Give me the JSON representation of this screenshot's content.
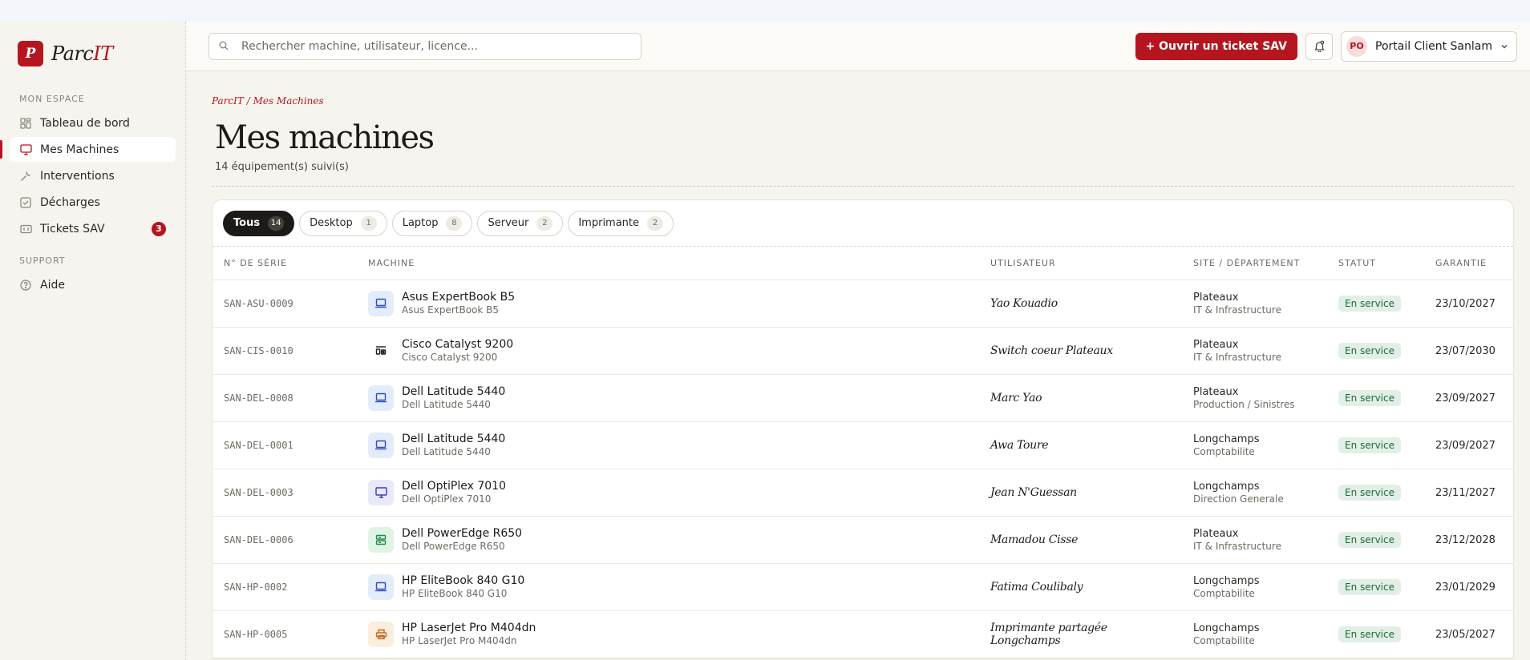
{
  "brand": {
    "mark": "P",
    "name_prefix": "Parc",
    "name_accent": "IT"
  },
  "sidebar": {
    "section_main": "Mon espace",
    "items": [
      {
        "label": "Tableau de bord",
        "icon": "grid-icon"
      },
      {
        "label": "Mes Machines",
        "icon": "monitor-icon",
        "active": true
      },
      {
        "label": "Interventions",
        "icon": "wrench-icon"
      },
      {
        "label": "Décharges",
        "icon": "checkbox-icon"
      },
      {
        "label": "Tickets SAV",
        "icon": "ticket-icon",
        "badge": "3"
      }
    ],
    "section_support": "Support",
    "support_items": [
      {
        "label": "Aide",
        "icon": "help-icon"
      }
    ]
  },
  "topbar": {
    "search_placeholder": "Rechercher machine, utilisateur, licence...",
    "open_ticket_label": "+ Ouvrir un ticket SAV",
    "account_initials": "PO",
    "account_name": "Portail Client Sanlam"
  },
  "page": {
    "breadcrumb": "ParcIT / Mes Machines",
    "title": "Mes machines",
    "subtitle": "14 équipement(s) suivi(s)"
  },
  "filters": [
    {
      "label": "Tous",
      "count": "14",
      "active": true
    },
    {
      "label": "Desktop",
      "count": "1"
    },
    {
      "label": "Laptop",
      "count": "8"
    },
    {
      "label": "Serveur",
      "count": "2"
    },
    {
      "label": "Imprimante",
      "count": "2"
    }
  ],
  "table": {
    "headers": [
      "N° de série",
      "Machine",
      "Utilisateur",
      "Site / Département",
      "Statut",
      "Garantie"
    ],
    "rows": [
      {
        "serial": "SAN-ASU-0009",
        "type": "laptop",
        "name": "Asus ExpertBook B5",
        "model": "Asus ExpertBook B5",
        "user": "Yao Kouadio",
        "site": "Plateaux",
        "dept": "IT & Infrastructure",
        "status": "En service",
        "warranty": "23/10/2027"
      },
      {
        "serial": "SAN-CIS-0010",
        "type": "switch",
        "name": "Cisco Catalyst 9200",
        "model": "Cisco Catalyst 9200",
        "user": "Switch coeur Plateaux",
        "site": "Plateaux",
        "dept": "IT & Infrastructure",
        "status": "En service",
        "warranty": "23/07/2030"
      },
      {
        "serial": "SAN-DEL-0008",
        "type": "laptop",
        "name": "Dell Latitude 5440",
        "model": "Dell Latitude 5440",
        "user": "Marc Yao",
        "site": "Plateaux",
        "dept": "Production / Sinistres",
        "status": "En service",
        "warranty": "23/09/2027"
      },
      {
        "serial": "SAN-DEL-0001",
        "type": "laptop",
        "name": "Dell Latitude 5440",
        "model": "Dell Latitude 5440",
        "user": "Awa Toure",
        "site": "Longchamps",
        "dept": "Comptabilite",
        "status": "En service",
        "warranty": "23/09/2027"
      },
      {
        "serial": "SAN-DEL-0003",
        "type": "desktop",
        "name": "Dell OptiPlex 7010",
        "model": "Dell OptiPlex 7010",
        "user": "Jean N'Guessan",
        "site": "Longchamps",
        "dept": "Direction Generale",
        "status": "En service",
        "warranty": "23/11/2027"
      },
      {
        "serial": "SAN-DEL-0006",
        "type": "server",
        "name": "Dell PowerEdge R650",
        "model": "Dell PowerEdge R650",
        "user": "Mamadou Cisse",
        "site": "Plateaux",
        "dept": "IT & Infrastructure",
        "status": "En service",
        "warranty": "23/12/2028"
      },
      {
        "serial": "SAN-HP-0002",
        "type": "laptop",
        "name": "HP EliteBook 840 G10",
        "model": "HP EliteBook 840 G10",
        "user": "Fatima Coulibaly",
        "site": "Longchamps",
        "dept": "Comptabilite",
        "status": "En service",
        "warranty": "23/01/2029"
      },
      {
        "serial": "SAN-HP-0005",
        "type": "printer",
        "name": "HP LaserJet Pro M404dn",
        "model": "HP LaserJet Pro M404dn",
        "user": "Imprimante partagée Longchamps",
        "site": "Longchamps",
        "dept": "Comptabilite",
        "status": "En service",
        "warranty": "23/05/2027"
      }
    ]
  },
  "colors": {
    "accent": "#b5151e",
    "status_bg": "#e2efe6",
    "status_text": "#1c6b3a"
  }
}
